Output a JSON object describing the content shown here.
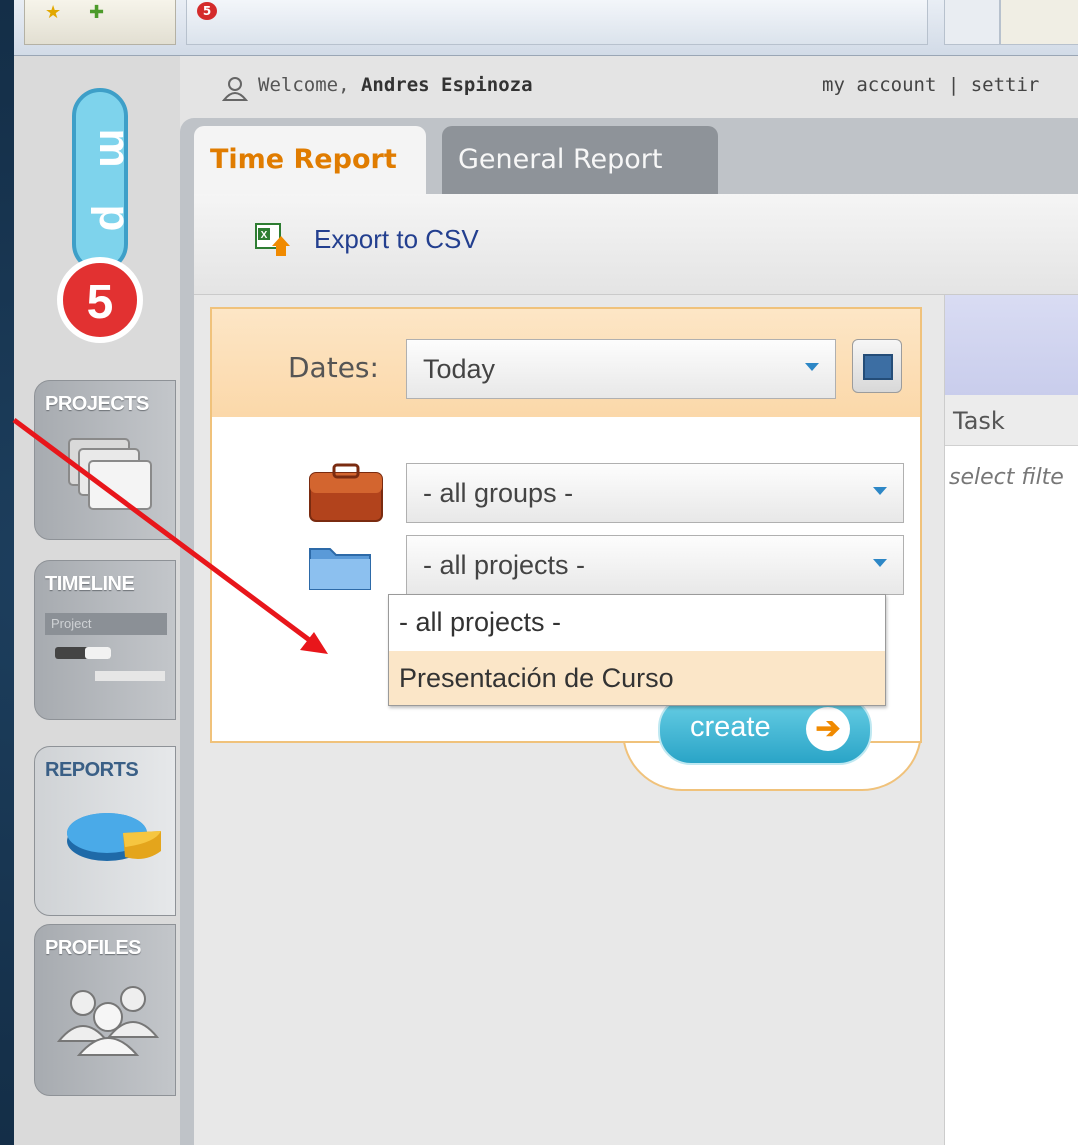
{
  "header": {
    "welcome_prefix": "Welcome, ",
    "user_name": "Andres Espinoza",
    "account_links": "my account | settir"
  },
  "browser": {
    "tab_logo": "5"
  },
  "sidebar": {
    "items": [
      {
        "label": "PROJECTS",
        "icon": "folders-icon"
      },
      {
        "label": "TIMELINE",
        "icon": "timeline-icon",
        "sublabel": "Project"
      },
      {
        "label": "REPORTS",
        "icon": "pie-chart-icon"
      },
      {
        "label": "PROFILES",
        "icon": "users-icon"
      }
    ]
  },
  "tabs": [
    {
      "label": "Time Report",
      "active": true
    },
    {
      "label": "General Report",
      "active": false
    }
  ],
  "toolbar": {
    "export_label": "Export to CSV"
  },
  "filter": {
    "dates_label": "Dates:",
    "dates_value": "Today",
    "groups_value": "- all groups -",
    "projects_value": "- all projects -",
    "project_options": [
      "- all projects -",
      "Presentación de Curso"
    ],
    "highlighted_option": "Presentación de Curso",
    "create_label": "create"
  },
  "report": {
    "column_task": "Task",
    "hint": "select filte"
  },
  "colors": {
    "active_tab": "#e07c00",
    "annotation_arrow": "#e8161b",
    "link": "#233f8f",
    "create_button": "#2aa4c7"
  }
}
